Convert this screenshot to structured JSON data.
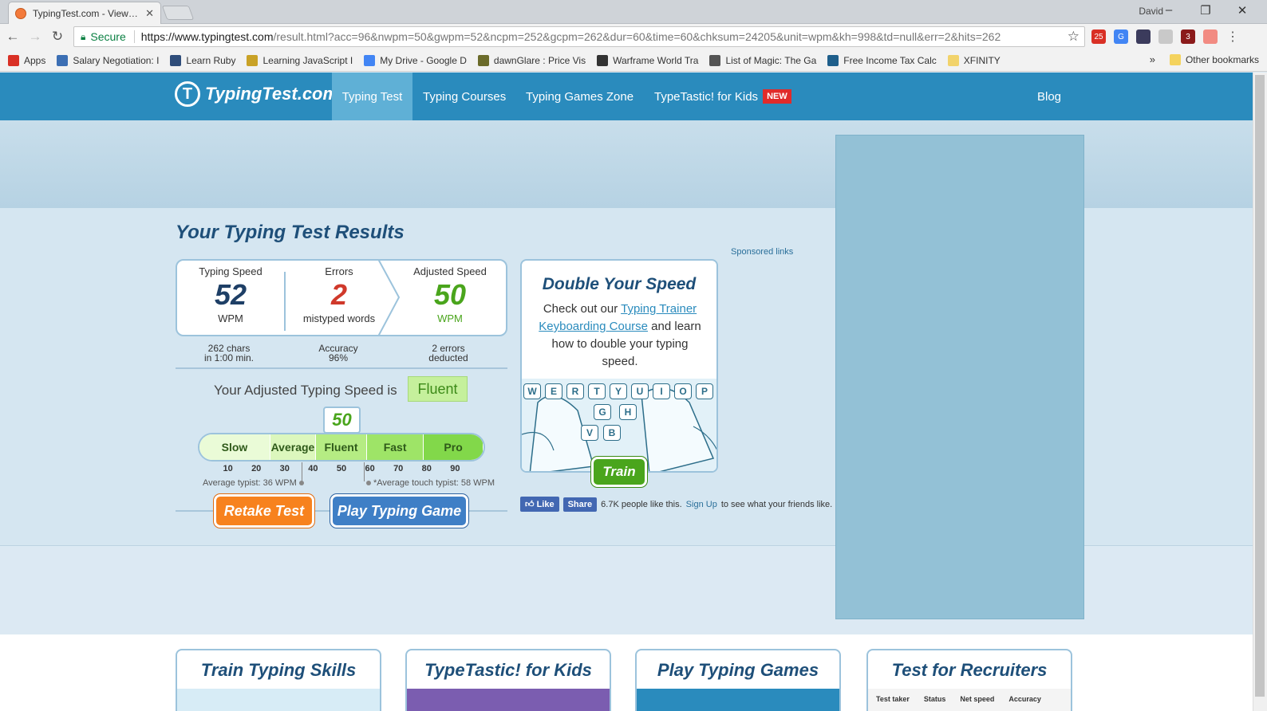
{
  "browser": {
    "tab_title": "TypingTest.com - View Yo",
    "user": "David",
    "secure_label": "Secure",
    "url_host": "https://www.typingtest.com",
    "url_rest": "/result.html?acc=96&nwpm=50&gwpm=52&ncpm=252&gcpm=262&dur=60&time=60&chksum=24205&unit=wpm&kh=998&td=null&err=2&hits=262",
    "ext_badges": [
      "25",
      "3"
    ],
    "bookmarks": [
      {
        "label": "Apps",
        "color": "#d93025"
      },
      {
        "label": "Salary Negotiation: I",
        "color": "#3c6fb4"
      },
      {
        "label": "Learn Ruby",
        "color": "#2f4d7a"
      },
      {
        "label": "Learning JavaScript I",
        "color": "#c9a227"
      },
      {
        "label": "My Drive - Google D",
        "color": "#4285f4"
      },
      {
        "label": "dawnGlare : Price Vis",
        "color": "#6b6b2a"
      },
      {
        "label": "Warframe World Tra",
        "color": "#333333"
      },
      {
        "label": "List of Magic: The Ga",
        "color": "#555555"
      },
      {
        "label": "Free Income Tax Calc",
        "color": "#1f5f8b"
      },
      {
        "label": "XFINITY",
        "color": "#f2d36b"
      }
    ],
    "other_bookmarks": "Other bookmarks"
  },
  "site": {
    "logo": "TypingTest.com",
    "nav": {
      "typing_test": "Typing Test",
      "typing_courses": "Typing Courses",
      "typing_games": "Typing Games Zone",
      "typetastic": "TypeTastic! for Kids",
      "new_badge": "NEW",
      "blog": "Blog"
    }
  },
  "results": {
    "title": "Your Typing Test Results",
    "typing_speed": {
      "label": "Typing Speed",
      "value": "52",
      "unit": "WPM",
      "sub1": "262 chars",
      "sub2": "in 1:00 min."
    },
    "errors": {
      "label": "Errors",
      "value": "2",
      "unit": "mistyped words",
      "sub1": "Accuracy",
      "sub2": "96%"
    },
    "adjusted": {
      "label": "Adjusted Speed",
      "value": "50",
      "unit": "WPM",
      "sub1": "2 errors",
      "sub2": "deducted"
    },
    "adjusted_text": "Your Adjusted Typing Speed is",
    "level": "Fluent",
    "marker_value": "50",
    "scale": {
      "min": 0,
      "max": 100,
      "segments": [
        {
          "label": "Slow",
          "to": 25,
          "color": "#eafbd7"
        },
        {
          "label": "Average",
          "to": 41,
          "color": "#dcf7bd"
        },
        {
          "label": "Fluent",
          "to": 59,
          "color": "#b5ec83"
        },
        {
          "label": "Fast",
          "to": 79,
          "color": "#9ee467"
        },
        {
          "label": "Pro",
          "to": 100,
          "color": "#82d84a"
        }
      ],
      "ticks": [
        "10",
        "20",
        "30",
        "40",
        "50",
        "60",
        "70",
        "80",
        "90"
      ]
    },
    "average_typist": "Average typist: 36 WPM",
    "average_touch_typist": "*Average touch typist: 58 WPM",
    "retake_button": "Retake Test",
    "play_button": "Play Typing Game"
  },
  "promo": {
    "title": "Double Your Speed",
    "text_before": "Check out our ",
    "link1": "Typing Trainer",
    "link2": "Keyboarding Course",
    "text_after": " and learn how to double your typing speed.",
    "keys_row1": [
      "W",
      "E",
      "R",
      "T",
      "Y",
      "U",
      "I",
      "O",
      "P"
    ],
    "keys_row2": [
      "G",
      "H"
    ],
    "keys_row3": [
      "V",
      "B"
    ],
    "train_button": "Train"
  },
  "sponsored": "Sponsored links",
  "facebook": {
    "like": "Like",
    "share": "Share",
    "count_text": "6.7K people like this.",
    "signup": "Sign Up",
    "after": "to see what your friends like."
  },
  "cards": [
    {
      "title": "Train Typing Skills",
      "color": "#d7ecf6"
    },
    {
      "title": "TypeTastic! for Kids",
      "color": "#7b5db0"
    },
    {
      "title": "Play Typing Games",
      "color": "#2a8bbd"
    },
    {
      "title": "Test for Recruiters",
      "color": "#f4f4f4"
    }
  ],
  "recruiter_table": [
    "Test taker",
    "Status",
    "Net speed",
    "Accuracy"
  ]
}
